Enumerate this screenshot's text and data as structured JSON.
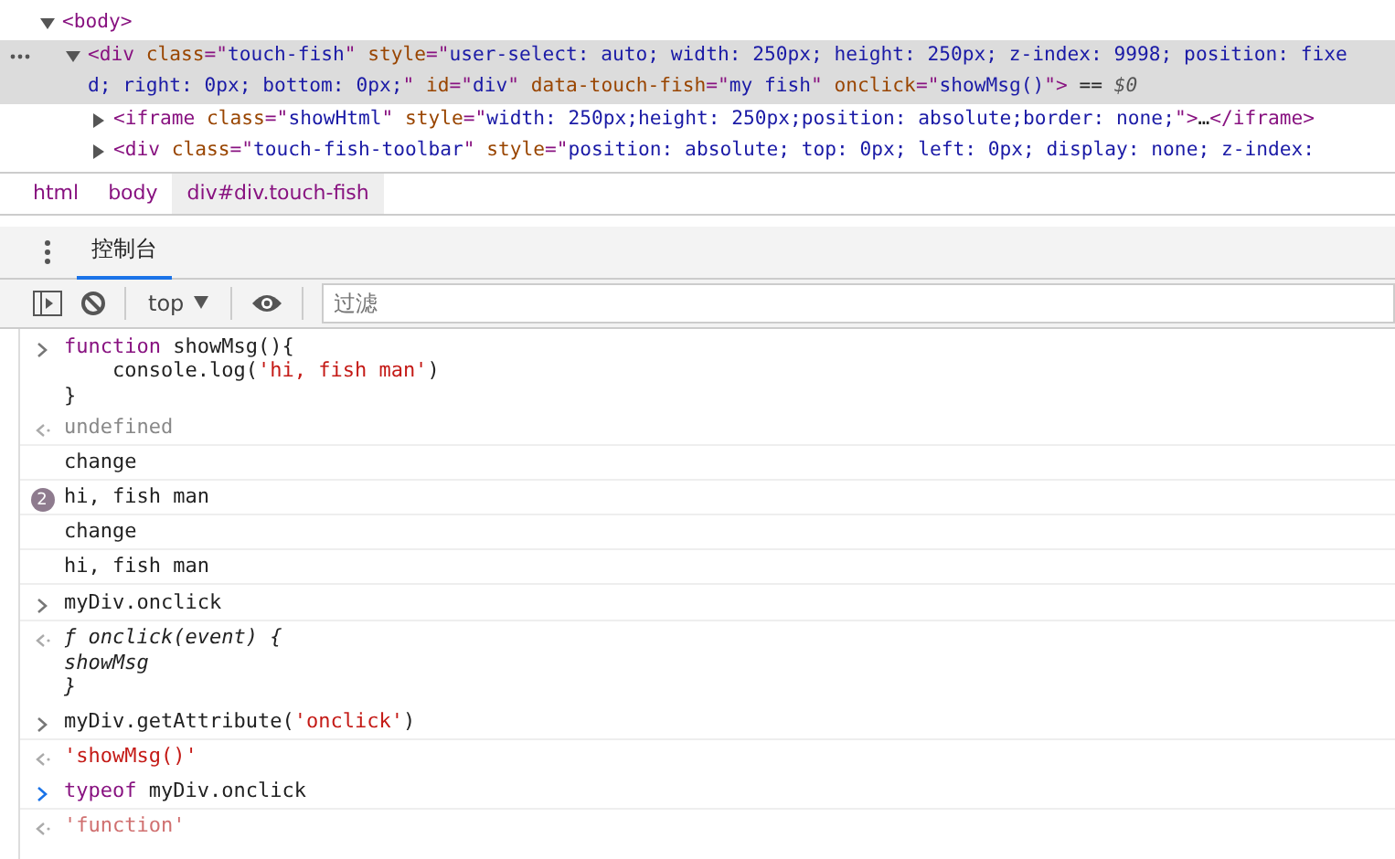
{
  "elements": [
    {
      "expanded": true,
      "selected": false,
      "tokens": [
        {
          "kind": "tag",
          "text": "<body>"
        }
      ],
      "children": [
        {
          "expanded": true,
          "selected": true,
          "tokens": [
            {
              "kind": "tag",
              "text": "<div "
            },
            {
              "kind": "attr",
              "text": "class"
            },
            {
              "kind": "tag",
              "text": "=\""
            },
            {
              "kind": "value",
              "text": "touch-fish"
            },
            {
              "kind": "tag",
              "text": "\" "
            },
            {
              "kind": "attr",
              "text": "style"
            },
            {
              "kind": "tag",
              "text": "=\""
            },
            {
              "kind": "value",
              "text": "user-select: auto; width: 250px; height: 250px; z-index: 9998; position: fixed; right: 0px; bottom: 0px;"
            },
            {
              "kind": "tag",
              "text": "\" "
            },
            {
              "kind": "attr",
              "text": "id"
            },
            {
              "kind": "tag",
              "text": "=\""
            },
            {
              "kind": "value",
              "text": "div"
            },
            {
              "kind": "tag",
              "text": "\" "
            },
            {
              "kind": "attr",
              "text": "data-touch-fish"
            },
            {
              "kind": "tag",
              "text": "=\""
            },
            {
              "kind": "value",
              "text": "my fish"
            },
            {
              "kind": "tag",
              "text": "\" "
            },
            {
              "kind": "attr",
              "text": "onclick"
            },
            {
              "kind": "tag",
              "text": "=\""
            },
            {
              "kind": "value",
              "text": "showMsg()"
            },
            {
              "kind": "tag",
              "text": "\">"
            },
            {
              "kind": "plain",
              "text": " == "
            },
            {
              "kind": "var",
              "text": "$0"
            }
          ],
          "children": [
            {
              "expanded": false,
              "selected": false,
              "tokens": [
                {
                  "kind": "tag",
                  "text": "<iframe "
                },
                {
                  "kind": "attr",
                  "text": "class"
                },
                {
                  "kind": "tag",
                  "text": "=\""
                },
                {
                  "kind": "value",
                  "text": "showHtml"
                },
                {
                  "kind": "tag",
                  "text": "\" "
                },
                {
                  "kind": "attr",
                  "text": "style"
                },
                {
                  "kind": "tag",
                  "text": "=\""
                },
                {
                  "kind": "value",
                  "text": "width: 250px;height: 250px;position: absolute;border: none;"
                },
                {
                  "kind": "tag",
                  "text": "\">"
                },
                {
                  "kind": "plain",
                  "text": "…"
                },
                {
                  "kind": "tag",
                  "text": "</iframe>"
                }
              ]
            },
            {
              "expanded": false,
              "selected": false,
              "tokens": [
                {
                  "kind": "tag",
                  "text": "<div "
                },
                {
                  "kind": "attr",
                  "text": "class"
                },
                {
                  "kind": "tag",
                  "text": "=\""
                },
                {
                  "kind": "value",
                  "text": "touch-fish-toolbar"
                },
                {
                  "kind": "tag",
                  "text": "\" "
                },
                {
                  "kind": "attr",
                  "text": "style"
                },
                {
                  "kind": "tag",
                  "text": "=\""
                },
                {
                  "kind": "value",
                  "text": "position: absolute; top: 0px; left: 0px; display: none; z-index:"
                }
              ]
            }
          ]
        }
      ]
    }
  ],
  "breadcrumbs": [
    {
      "label": "html",
      "selected": false
    },
    {
      "label": "body",
      "selected": false
    },
    {
      "label": "div#div.touch-fish",
      "selected": true
    }
  ],
  "drawer_tabs": [
    {
      "label": "控制台",
      "selected": true
    }
  ],
  "toolbar": {
    "context": "top",
    "filter": {
      "placeholder": "过滤"
    }
  },
  "console": [
    {
      "kind": "input",
      "lines": [
        [
          {
            "kind": "keyword",
            "text": "function"
          },
          {
            "kind": "plain",
            "text": " showMsg(){"
          }
        ],
        [
          {
            "kind": "plain",
            "text": "    console.log("
          },
          {
            "kind": "string",
            "text": "'hi, fish man'"
          },
          {
            "kind": "plain",
            "text": ")"
          }
        ],
        [
          {
            "kind": "plain",
            "text": "}"
          }
        ]
      ]
    },
    {
      "kind": "result",
      "lines": [
        [
          {
            "kind": "muted",
            "text": "undefined"
          }
        ]
      ]
    },
    {
      "kind": "log",
      "lines": [
        [
          {
            "kind": "plain",
            "text": "change"
          }
        ]
      ]
    },
    {
      "kind": "log",
      "count": "2",
      "lines": [
        [
          {
            "kind": "plain",
            "text": "hi, fish man"
          }
        ]
      ]
    },
    {
      "kind": "log",
      "lines": [
        [
          {
            "kind": "plain",
            "text": "change"
          }
        ]
      ]
    },
    {
      "kind": "log",
      "lines": [
        [
          {
            "kind": "plain",
            "text": "hi, fish man"
          }
        ]
      ]
    },
    {
      "kind": "input",
      "lines": [
        [
          {
            "kind": "plain",
            "text": "myDiv.onclick"
          }
        ]
      ]
    },
    {
      "kind": "result",
      "lines": [
        [
          {
            "kind": "italic",
            "text": "ƒ onclick(event) {"
          }
        ],
        [
          {
            "kind": "italic",
            "text": "showMsg"
          }
        ],
        [
          {
            "kind": "italic",
            "text": "}"
          }
        ]
      ]
    },
    {
      "kind": "input",
      "lines": [
        [
          {
            "kind": "plain",
            "text": "myDiv.getAttribute("
          },
          {
            "kind": "string",
            "text": "'onclick'"
          },
          {
            "kind": "plain",
            "text": ")"
          }
        ]
      ]
    },
    {
      "kind": "result",
      "lines": [
        [
          {
            "kind": "string",
            "text": "'showMsg()'"
          }
        ]
      ]
    },
    {
      "kind": "prompt",
      "lines": [
        [
          {
            "kind": "keyword",
            "text": "typeof"
          },
          {
            "kind": "plain",
            "text": " myDiv.onclick"
          }
        ]
      ]
    },
    {
      "kind": "preview",
      "lines": [
        [
          {
            "kind": "faded",
            "text": "'function'"
          }
        ]
      ]
    }
  ]
}
